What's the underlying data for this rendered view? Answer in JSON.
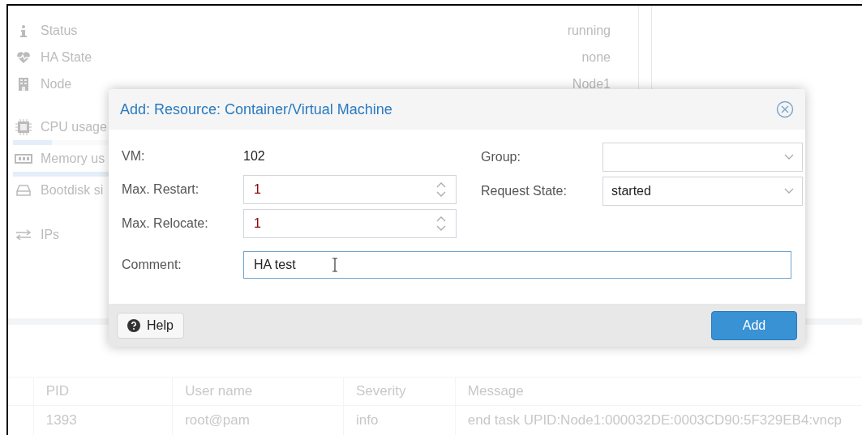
{
  "summary": [
    {
      "kind": "status",
      "label": "Status",
      "value": "running"
    },
    {
      "kind": "ha",
      "label": "HA State",
      "value": "none"
    },
    {
      "kind": "node",
      "label": "Node",
      "value": "Node1"
    },
    {
      "kind": "cpu",
      "label": "CPU usage",
      "level": 0.12
    },
    {
      "kind": "memory",
      "label": "Memory us",
      "level": 0.6
    },
    {
      "kind": "disk",
      "label": "Bootdisk si"
    },
    {
      "kind": "ips",
      "label": "IPs"
    }
  ],
  "log": {
    "columns": [
      "PID",
      "User name",
      "Severity",
      "Message"
    ],
    "rows": [
      [
        "1393",
        "root@pam",
        "info",
        "end task UPID:Node1:000032DE:0003CD90:5F329EB4:vncp"
      ]
    ]
  },
  "dialog": {
    "title": "Add: Resource: Container/Virtual Machine",
    "vm": {
      "label": "VM:",
      "value": "102"
    },
    "max_restart": {
      "label": "Max. Restart:",
      "value": "1"
    },
    "max_relocate": {
      "label": "Max. Relocate:",
      "value": "1"
    },
    "group": {
      "label": "Group:"
    },
    "request_state": {
      "label": "Request State:",
      "value": "started"
    },
    "comment": {
      "label": "Comment:",
      "value": "HA test"
    },
    "help_button": "Help",
    "add_button": "Add"
  }
}
